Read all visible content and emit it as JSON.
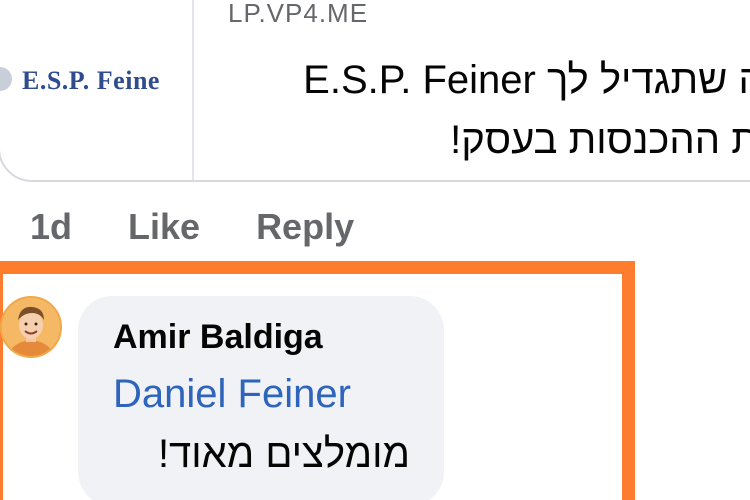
{
  "link_preview": {
    "thumbnail_brand": "E.S.P. Feine",
    "domain": "LP.VP4.ME",
    "title_line1": "רה שתגדיל לך E.S.P. Feiner",
    "title_line2": "את ההכנסות בעסק!"
  },
  "actions": {
    "time": "1d",
    "like": "Like",
    "reply": "Reply"
  },
  "comment": {
    "author": "Amir Baldiga",
    "mention": "Daniel Feiner",
    "text": "מומלצים מאוד!"
  },
  "colors": {
    "highlight": "#fd7c2e",
    "mention_link": "#2d64bc",
    "bubble_bg": "#f0f2f5",
    "secondary_text": "#65676b"
  }
}
